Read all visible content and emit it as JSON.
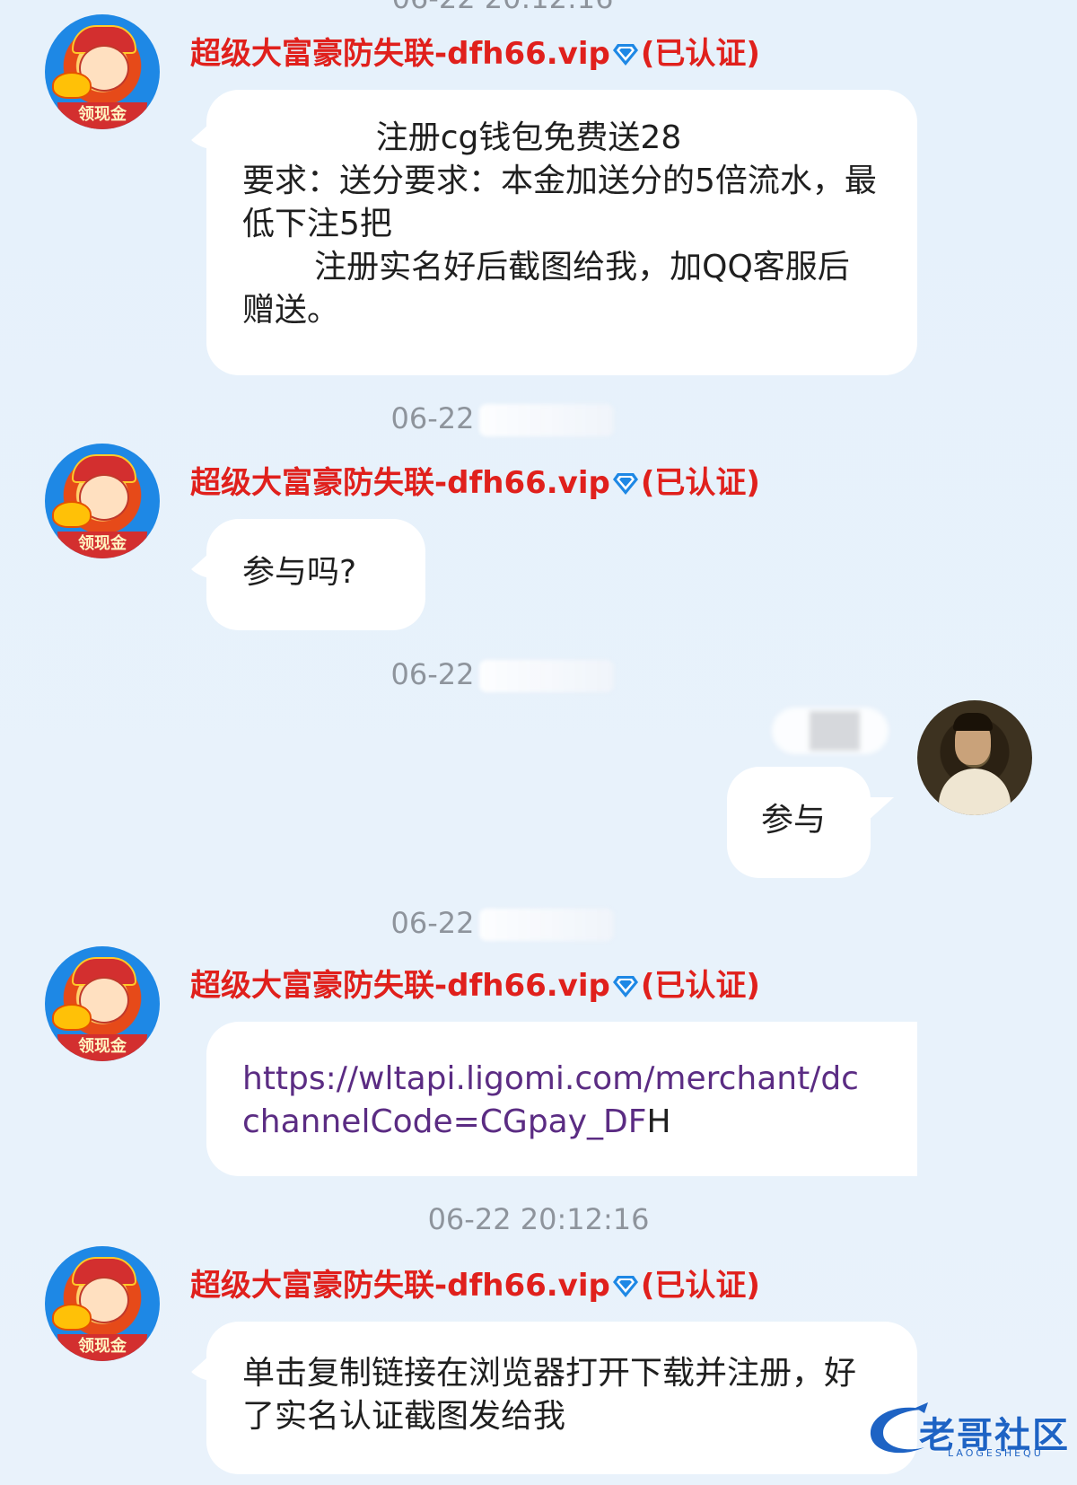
{
  "timestamps": {
    "t1": "06-22",
    "t2": "06-22",
    "t3": "06-22",
    "t4": "06-22 20:12:16"
  },
  "sender": {
    "name": "超级大富豪防失联-dfh66.vip",
    "verified": "(已认证)",
    "avatar_ribbon": "领现金",
    "name_color": "#e0201c"
  },
  "messages": {
    "m1_text": "             注册cg钱包免费送28\n要求：送分要求：本金加送分的5倍流水，最低下注5把\n       注册实名好后截图给我，加QQ客服后赠送。",
    "m2_text": "参与吗?",
    "m3_text": "参与",
    "m4_link": "https://wltapi.ligomi.com/merchant/dc",
    "m4_link_cont": "channelCode=CGpay_DF",
    "m4_tail": "H",
    "m5_text": "单击复制链接在浏览器打开下载并注册，好了实名认证截图发给我"
  },
  "watermark": {
    "title": "老哥社区",
    "sub": "LAOGESHEQU"
  },
  "colors": {
    "background": "#e6f1fb",
    "bubble": "#ffffff",
    "timestamp": "#8e949c",
    "link": "#5b2c83",
    "watermark": "#1e63c4",
    "verified_icon": "#1e88e5"
  }
}
